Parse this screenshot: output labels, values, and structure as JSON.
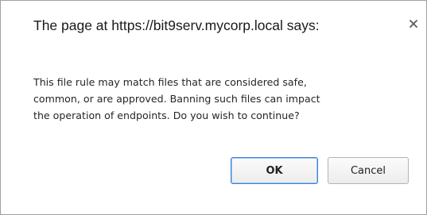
{
  "dialog": {
    "title": "The page at https://bit9serv.mycorp.local says:",
    "close_icon": "close-icon",
    "message_lines": [
      "This file rule may match files that are considered safe,",
      "common, or are approved.  Banning such files can impact",
      "the operation of endpoints.  Do you wish to continue?"
    ],
    "ok_label": "OK",
    "cancel_label": "Cancel",
    "focus_color": "#3b7fd9"
  }
}
